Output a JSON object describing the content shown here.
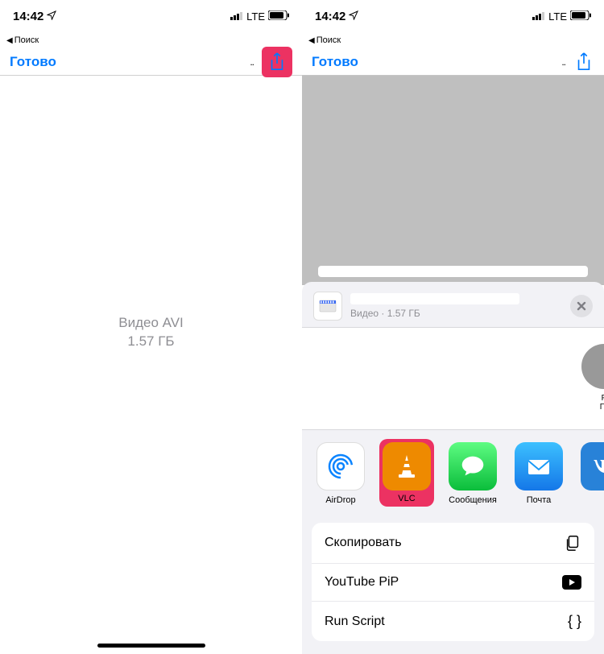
{
  "status": {
    "time": "14:42",
    "network": "LTE"
  },
  "back_label": "Поиск",
  "nav": {
    "done": "Готово"
  },
  "file": {
    "label": "Видео AVI",
    "size": "1.57 ГБ"
  },
  "sheet": {
    "meta": "Видео · 1.57 ГБ",
    "contact_partial_line1": "Р",
    "contact_partial_line2": "Гр",
    "apps": [
      {
        "name": "AirDrop"
      },
      {
        "name": "VLC"
      },
      {
        "name": "Сообщения"
      },
      {
        "name": "Почта"
      }
    ],
    "actions": [
      {
        "label": "Скопировать",
        "icon": "copy"
      },
      {
        "label": "YouTube PiP",
        "icon": "youtube"
      },
      {
        "label": "Run Script",
        "icon": "braces"
      }
    ]
  },
  "colors": {
    "accent": "#007aff",
    "highlight": "#ec3262",
    "airdrop_bg": "#ffffff",
    "vlc_bg": "#ee8a00",
    "messages_bg": "#33d157",
    "mail_bg": "#1a9af7",
    "vk_bg": "#2882d8"
  }
}
